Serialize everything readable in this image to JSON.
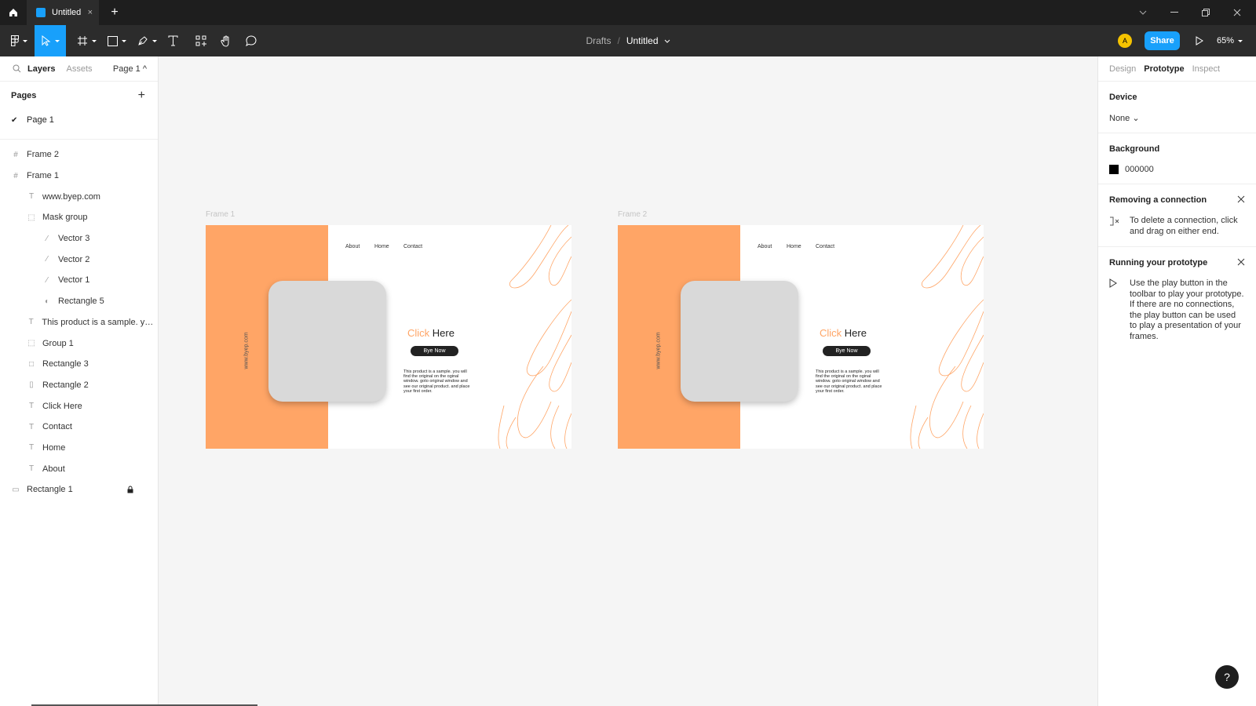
{
  "titlebar": {
    "tab_title": "Untitled",
    "tab_close": "×",
    "new_tab": "+",
    "window_icons": [
      "chevron-down-icon",
      "minimize-icon",
      "restore-icon",
      "close-icon"
    ]
  },
  "toolbar": {
    "tools": [
      "main-menu",
      "move",
      "frame",
      "shape",
      "pen",
      "text",
      "components",
      "hand",
      "comment"
    ],
    "breadcrumb_drafts": "Drafts",
    "breadcrumb_sep": "/",
    "file_name": "Untitled",
    "avatar_initial": "A",
    "share_label": "Share",
    "zoom_label": "65%"
  },
  "left_panel": {
    "tabs": {
      "layers": "Layers",
      "assets": "Assets"
    },
    "page_selector": "Page 1 ^",
    "pages_heading": "Pages",
    "add_page": "+",
    "pages": [
      {
        "check": "✔",
        "label": "Page 1"
      }
    ],
    "layers": [
      {
        "label": "Frame 2",
        "icon": "#",
        "indent": 0
      },
      {
        "label": "Frame 1",
        "icon": "#",
        "indent": 0
      },
      {
        "label": "www.byep.com",
        "icon": "T",
        "indent": 1
      },
      {
        "label": "Mask group",
        "icon": "⬚",
        "indent": 1
      },
      {
        "label": "Vector 3",
        "icon": "⁄",
        "indent": 2
      },
      {
        "label": "Vector 2",
        "icon": "⁄",
        "indent": 2
      },
      {
        "label": "Vector 1",
        "icon": "⁄",
        "indent": 2
      },
      {
        "label": "Rectangle 5",
        "icon": "◐",
        "indent": 2
      },
      {
        "label": "This product is a sample. you ...",
        "icon": "T",
        "indent": 1
      },
      {
        "label": "Group 1",
        "icon": "⬚",
        "indent": 1
      },
      {
        "label": "Rectangle 3",
        "icon": "□",
        "indent": 1
      },
      {
        "label": "Rectangle 2",
        "icon": "▯",
        "indent": 1
      },
      {
        "label": "Click Here",
        "icon": "T",
        "indent": 1
      },
      {
        "label": "Contact",
        "icon": "T",
        "indent": 1
      },
      {
        "label": "Home",
        "icon": "T",
        "indent": 1
      },
      {
        "label": "About",
        "icon": "T",
        "indent": 1
      },
      {
        "label": "Rectangle 1",
        "icon": "▭",
        "indent": 0,
        "locked": true
      }
    ]
  },
  "right_panel": {
    "tabs": {
      "design": "Design",
      "prototype": "Prototype",
      "inspect": "Inspect"
    },
    "device_heading": "Device",
    "device_value": "None ⌄",
    "background_heading": "Background",
    "background_hex": "000000",
    "removing_heading": "Removing a connection",
    "removing_text": "To delete a connection, click and drag on either end.",
    "running_heading": "Running your prototype",
    "running_text": "Use the play button in the toolbar to play your prototype. If there are no connections, the play button can be used to play a presentation of your frames.",
    "help": "?"
  },
  "frames": [
    {
      "label": "Frame 1",
      "vertical_text": "www.byep.com",
      "nav": [
        "About",
        "Home",
        "Contact"
      ],
      "headline_accent": "Click",
      "headline_rest": " Here",
      "cta": "Bye Now",
      "desc": "This product is a sample. you will find the original on the oginal window. goto original window and see our original product. and place your first order."
    },
    {
      "label": "Frame 2",
      "vertical_text": "www.byep.com",
      "nav": [
        "About",
        "Home",
        "Contact"
      ],
      "headline_accent": "Click",
      "headline_rest": " Here",
      "cta": "Bye Now",
      "desc": "This product is a sample. you will find the original on the oginal window. goto original window and see our original product. and place your first order."
    }
  ],
  "colors": {
    "accent": "#18a0fb",
    "brand_orange": "#ffa566",
    "toolbar_bg": "#2c2c2c"
  }
}
